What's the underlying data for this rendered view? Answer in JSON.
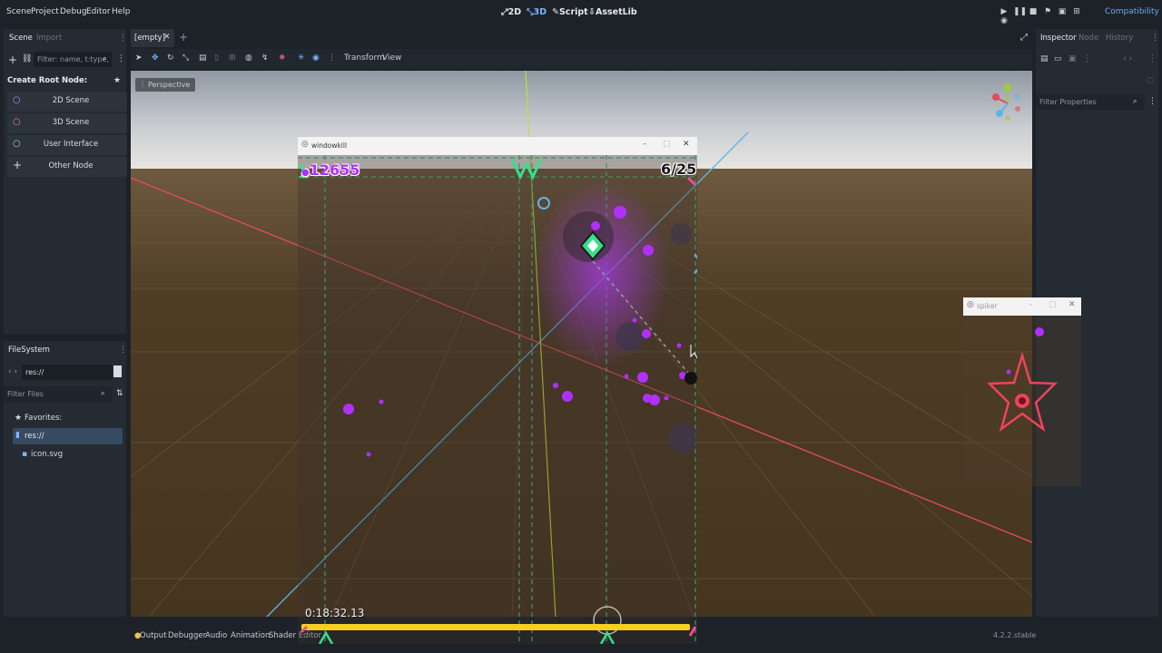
{
  "menubar": {
    "items": [
      "Scene",
      "Project",
      "Debug",
      "Editor",
      "Help"
    ],
    "modes": [
      "2D",
      "3D",
      "Script",
      "AssetLib"
    ],
    "renderer": "Compatibility"
  },
  "scene_dock": {
    "tabs": [
      "Scene",
      "Import"
    ],
    "filter_placeholder": "Filter: name, t:type,",
    "create_root_title": "Create Root Node:",
    "root_options": [
      {
        "label": "2D Scene",
        "icon": "circle-icon",
        "color": "#8da5f3"
      },
      {
        "label": "3D Scene",
        "icon": "circle-icon",
        "color": "#fc7f7f"
      },
      {
        "label": "User Interface",
        "icon": "circle-icon",
        "color": "#8eef97"
      },
      {
        "label": "Other Node",
        "icon": "plus-icon",
        "color": "#e0e0e0"
      }
    ]
  },
  "filesystem_dock": {
    "title": "FileSystem",
    "path": "res://",
    "filter_placeholder": "Filter Files",
    "favorites_label": "Favorites:",
    "tree": [
      "res://",
      "icon.svg"
    ]
  },
  "editor_tabs": {
    "scene_tab": "[empty]"
  },
  "viewport_toolbar": {
    "transform_label": "Transform",
    "view_label": "View",
    "perspective_label": "Perspective"
  },
  "inspector_dock": {
    "tabs": [
      "Inspector",
      "Node",
      "History"
    ],
    "filter_placeholder": "Filter Properties"
  },
  "bottom_panel": {
    "tabs": [
      "Output",
      "Debugger",
      "Audio",
      "Animation",
      "Shader Editor"
    ],
    "version": "4.2.2.stable"
  },
  "game_window": {
    "title": "windowkill",
    "score": "12655",
    "wave": "6/25",
    "timer": "0:18:32.13",
    "health_fraction": 1.0
  },
  "spiker_window": {
    "title": "spiker"
  },
  "colors": {
    "accent": "#478cbf",
    "axis_x": "#e24c5f",
    "axis_z": "#5bb6e8",
    "axis_y": "#b9e23a",
    "enemy": "#b12fff",
    "player": "#36e08a",
    "health_bar": "#f5d020"
  }
}
